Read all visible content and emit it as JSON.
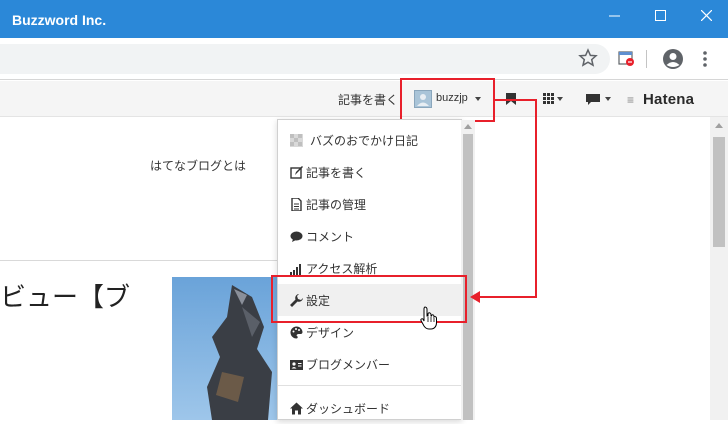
{
  "window": {
    "title": "Buzzword Inc.",
    "titlebar_color": "#2b88d8"
  },
  "browser_toolbar": {
    "icons": [
      "star-icon",
      "extension-icon",
      "profile-icon",
      "more-icon"
    ]
  },
  "hatena_bar": {
    "write_link": "記事を書く",
    "username": "buzzjp",
    "logo_text": "Hatena"
  },
  "page": {
    "link_text": "はてなブログとは",
    "headline": "ビュー【ブ"
  },
  "dropdown": {
    "items": [
      {
        "label": "バズのおでかけ日記",
        "icon": "blog-icon"
      },
      {
        "label": "記事を書く",
        "icon": "edit-icon"
      },
      {
        "label": "記事の管理",
        "icon": "document-icon"
      },
      {
        "label": "コメント",
        "icon": "comment-icon"
      },
      {
        "label": "アクセス解析",
        "icon": "bar-chart-icon"
      },
      {
        "label": "設定",
        "icon": "wrench-icon"
      },
      {
        "label": "デザイン",
        "icon": "palette-icon"
      },
      {
        "label": "ブログメンバー",
        "icon": "member-icon"
      },
      {
        "label": "ダッシュボード",
        "icon": "home-icon"
      }
    ]
  },
  "annotation": {
    "highlight_color": "#e8202b"
  }
}
